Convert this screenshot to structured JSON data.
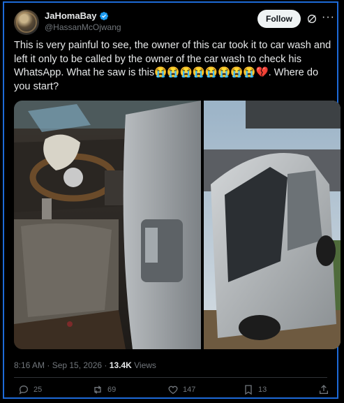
{
  "header": {
    "display_name": "JaHomaBay",
    "handle": "@HassanMcOjwang",
    "follow_label": "Follow"
  },
  "tweet": {
    "text": "This is very painful to see, the owner of this car took it to car wash and left it only to be called by the owner of the car wash to check his WhatsApp.  What he saw is this😭😭😭😭😭😭😭😭💔. Where do you start?"
  },
  "meta": {
    "timestamp": "8:16 AM · Sep 15, 2026 · ",
    "views_count": "13.4K",
    "views_label": " Views"
  },
  "actions": {
    "replies": "25",
    "reposts": "69",
    "likes": "147",
    "bookmarks": "13"
  },
  "colors": {
    "verified": "#1d9bf0",
    "border": "#1d6ad8"
  }
}
